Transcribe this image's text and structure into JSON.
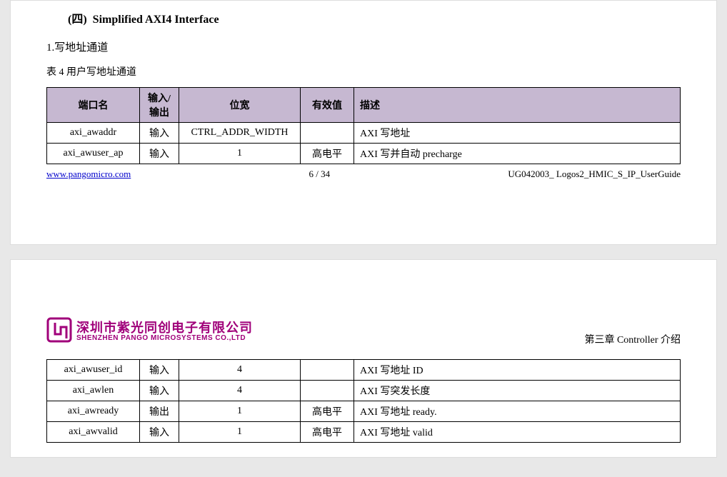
{
  "section": {
    "number_label": "(四)",
    "title": "Simplified AXI4 Interface"
  },
  "subsection": {
    "label": "1.写地址通道"
  },
  "table_caption": "表 4    用户写地址通道",
  "headers": {
    "port": "端口名",
    "dir": "输入/输出",
    "width": "位宽",
    "valid": "有效值",
    "desc": "描述"
  },
  "rows_top": [
    {
      "port": "axi_awaddr",
      "dir": "输入",
      "width": "CTRL_ADDR_WIDTH",
      "valid": "",
      "desc": "AXI 写地址"
    },
    {
      "port": "axi_awuser_ap",
      "dir": "输入",
      "width": "1",
      "valid": "高电平",
      "desc": "AXI 写并自动 precharge"
    }
  ],
  "rows_bottom": [
    {
      "port": "axi_awuser_id",
      "dir": "输入",
      "width": "4",
      "valid": "",
      "desc": "AXI 写地址 ID"
    },
    {
      "port": "axi_awlen",
      "dir": "输入",
      "width": "4",
      "valid": "",
      "desc": "AXI 写突发长度"
    },
    {
      "port": "axi_awready",
      "dir": "输出",
      "width": "1",
      "valid": "高电平",
      "desc": "AXI 写地址 ready."
    },
    {
      "port": "axi_awvalid",
      "dir": "输入",
      "width": "1",
      "valid": "高电平",
      "desc": "AXI 写地址 valid"
    }
  ],
  "footer": {
    "url": "www.pangomicro.com",
    "pager": "6 / 34",
    "docid": "UG042003_ Logos2_HMIC_S_IP_UserGuide"
  },
  "brand": {
    "cn": "深圳市紫光同创电子有限公司",
    "en": "SHENZHEN PANGO MICROSYSTEMS CO.,LTD"
  },
  "chapter": "第三章  Controller 介绍"
}
